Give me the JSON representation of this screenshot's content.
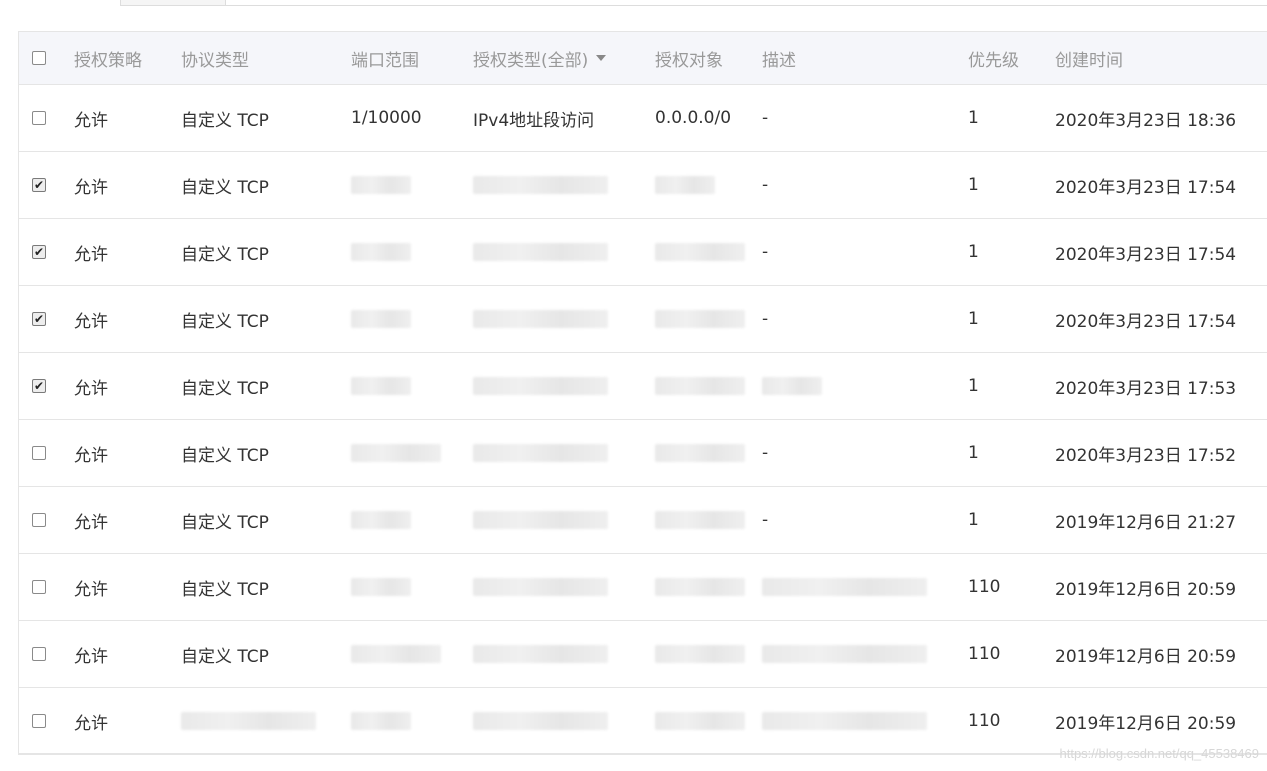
{
  "table": {
    "header": {
      "policy": "授权策略",
      "protocol": "协议类型",
      "port": "端口范围",
      "auth_type": "授权类型(全部)",
      "auth_object": "授权对象",
      "description": "描述",
      "priority": "优先级",
      "created": "创建时间"
    },
    "rows": [
      {
        "checked": false,
        "policy": "允许",
        "protocol": "自定义 TCP",
        "port": "1/10000",
        "auth_type": "IPv4地址段访问",
        "auth_object": "0.0.0.0/0",
        "description": "-",
        "priority": "1",
        "created": "2020年3月23日 18:36"
      },
      {
        "checked": true,
        "policy": "允许",
        "protocol": "自定义 TCP",
        "port": "",
        "auth_type": "",
        "auth_object": "",
        "description": "-",
        "priority": "1",
        "created": "2020年3月23日 17:54"
      },
      {
        "checked": true,
        "policy": "允许",
        "protocol": "自定义 TCP",
        "port": "",
        "auth_type": "",
        "auth_object": "",
        "description": "-",
        "priority": "1",
        "created": "2020年3月23日 17:54"
      },
      {
        "checked": true,
        "policy": "允许",
        "protocol": "自定义 TCP",
        "port": "",
        "auth_type": "",
        "auth_object": "",
        "description": "-",
        "priority": "1",
        "created": "2020年3月23日 17:54"
      },
      {
        "checked": true,
        "policy": "允许",
        "protocol": "自定义 TCP",
        "port": "",
        "auth_type": "",
        "auth_object": "",
        "description": "",
        "priority": "1",
        "created": "2020年3月23日 17:53"
      },
      {
        "checked": false,
        "policy": "允许",
        "protocol": "自定义 TCP",
        "port": "",
        "auth_type": "",
        "auth_object": "",
        "description": "-",
        "priority": "1",
        "created": "2020年3月23日 17:52"
      },
      {
        "checked": false,
        "policy": "允许",
        "protocol": "自定义 TCP",
        "port": "",
        "auth_type": "",
        "auth_object": "",
        "description": "-",
        "priority": "1",
        "created": "2019年12月6日 21:27"
      },
      {
        "checked": false,
        "policy": "允许",
        "protocol": "自定义 TCP",
        "port": "",
        "auth_type": "",
        "auth_object": "",
        "description": "",
        "priority": "110",
        "created": "2019年12月6日 20:59"
      },
      {
        "checked": false,
        "policy": "允许",
        "protocol": "自定义 TCP",
        "port": "",
        "auth_type": "",
        "auth_object": "",
        "description": "",
        "priority": "110",
        "created": "2019年12月6日 20:59"
      },
      {
        "checked": false,
        "policy": "允许",
        "protocol": "",
        "port": "",
        "auth_type": "",
        "auth_object": "",
        "description": "",
        "priority": "110",
        "created": "2019年12月6日 20:59"
      }
    ]
  },
  "watermark": "https://blog.csdn.net/qq_45538469",
  "colors": {
    "header_bg": "#f5f6fa",
    "border": "#e5e5e5",
    "header_text": "#999999",
    "body_text": "#333333"
  }
}
